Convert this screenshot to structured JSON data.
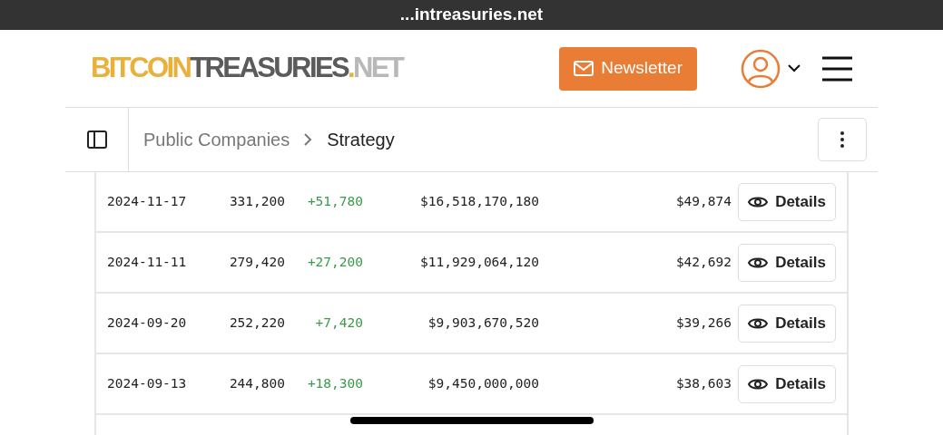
{
  "browser": {
    "url": "...intreasuries.net"
  },
  "logo": {
    "parts": [
      {
        "text": "BITCOIN",
        "color": "#e9b13b"
      },
      {
        "text": "TREASURIES",
        "color": "#5b5b5b"
      },
      {
        "text": ".",
        "color": "#e9b13b"
      },
      {
        "text": "NET",
        "color": "#b8b8b8"
      }
    ]
  },
  "newsletter_button": {
    "label": "Newsletter"
  },
  "breadcrumb": [
    "Public Companies",
    "Strategy"
  ],
  "rows": [
    {
      "date": "2024-11-17",
      "holdings": "331,200",
      "change": "+51,780",
      "cost": "$16,518,170,180",
      "avg_price": "$49,874",
      "action": "Details"
    },
    {
      "date": "2024-11-11",
      "holdings": "279,420",
      "change": "+27,200",
      "cost": "$11,929,064,120",
      "avg_price": "$42,692",
      "action": "Details"
    },
    {
      "date": "2024-09-20",
      "holdings": "252,220",
      "change": "+7,420",
      "cost": "$9,903,670,520",
      "avg_price": "$39,266",
      "action": "Details"
    },
    {
      "date": "2024-09-13",
      "holdings": "244,800",
      "change": "+18,300",
      "cost": "$9,450,000,000",
      "avg_price": "$38,603",
      "action": "Details"
    }
  ]
}
